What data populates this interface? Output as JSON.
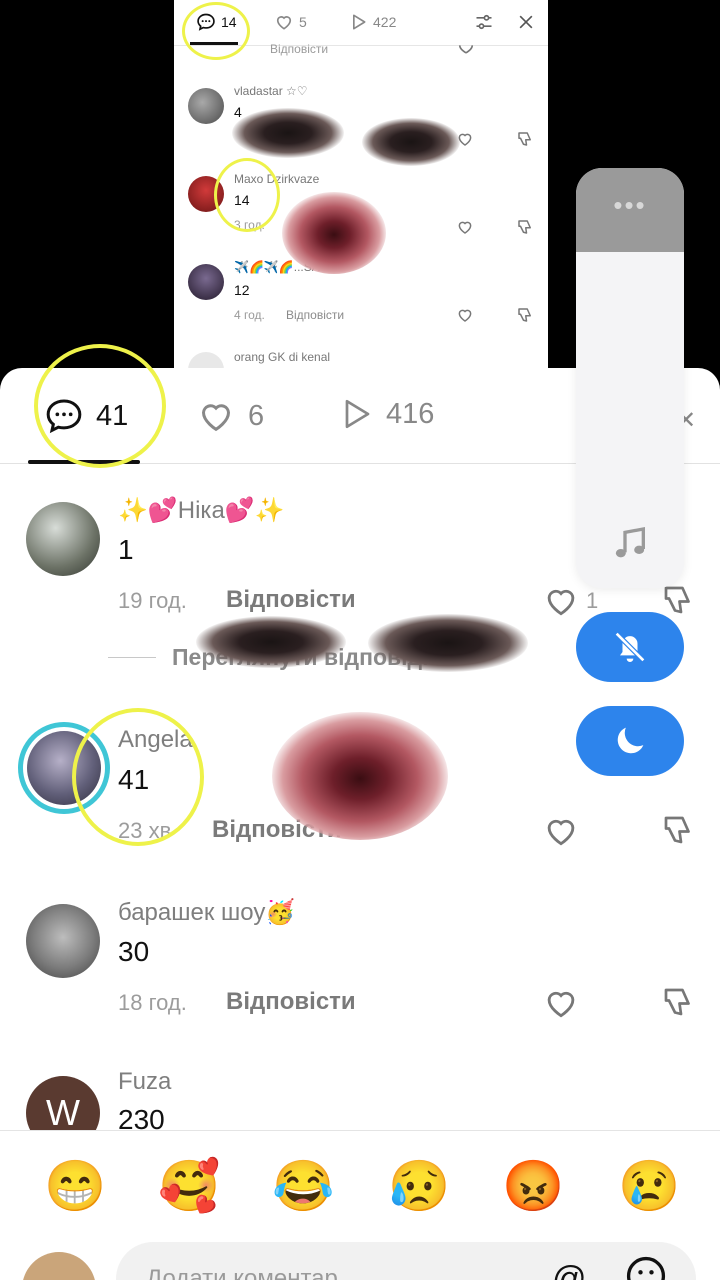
{
  "background_panel": {
    "tabs": {
      "comments": "14",
      "likes": "5",
      "views": "422"
    },
    "reply_label": "Відповісти",
    "comments": [
      {
        "name": "vladastar ☆♡",
        "text": "4",
        "time": ""
      },
      {
        "name": "Maxo Dzirkvaze",
        "text": "14",
        "time": "3 год."
      },
      {
        "name": "✈️🌈✈️🌈...SA",
        "text": "12",
        "time": "4 год."
      },
      {
        "name": "orang GK di kenal",
        "text": "",
        "time": ""
      }
    ]
  },
  "sheet": {
    "tabs": {
      "comments_count": "41",
      "likes_count": "6",
      "views_count": "416"
    },
    "reply_label": "Відповісти",
    "view_replies_label": "Переглянути відповіді: 3",
    "comments": [
      {
        "name": "✨💕Ніка💕✨",
        "text": "1",
        "time": "19 год.",
        "likes": "1"
      },
      {
        "name": "Angela",
        "text": "41",
        "time": "23 хв",
        "likes": ""
      },
      {
        "name": "барашек шоу🥳",
        "text": "30",
        "time": "18 год.",
        "likes": ""
      },
      {
        "name": "Fuza",
        "text": "230",
        "time": "",
        "likes": "",
        "avatar_letter": "W"
      }
    ],
    "emojis": [
      "😁",
      "🥰",
      "😂",
      "😥",
      "😡",
      "😢"
    ],
    "input": {
      "placeholder": "Додати коментар..."
    }
  },
  "side_panel": {
    "dots": "•••"
  },
  "colors": {
    "accent_blue": "#2d84ec",
    "highlight_yellow": "#eef24a",
    "story_ring": "#3fc6d6"
  }
}
